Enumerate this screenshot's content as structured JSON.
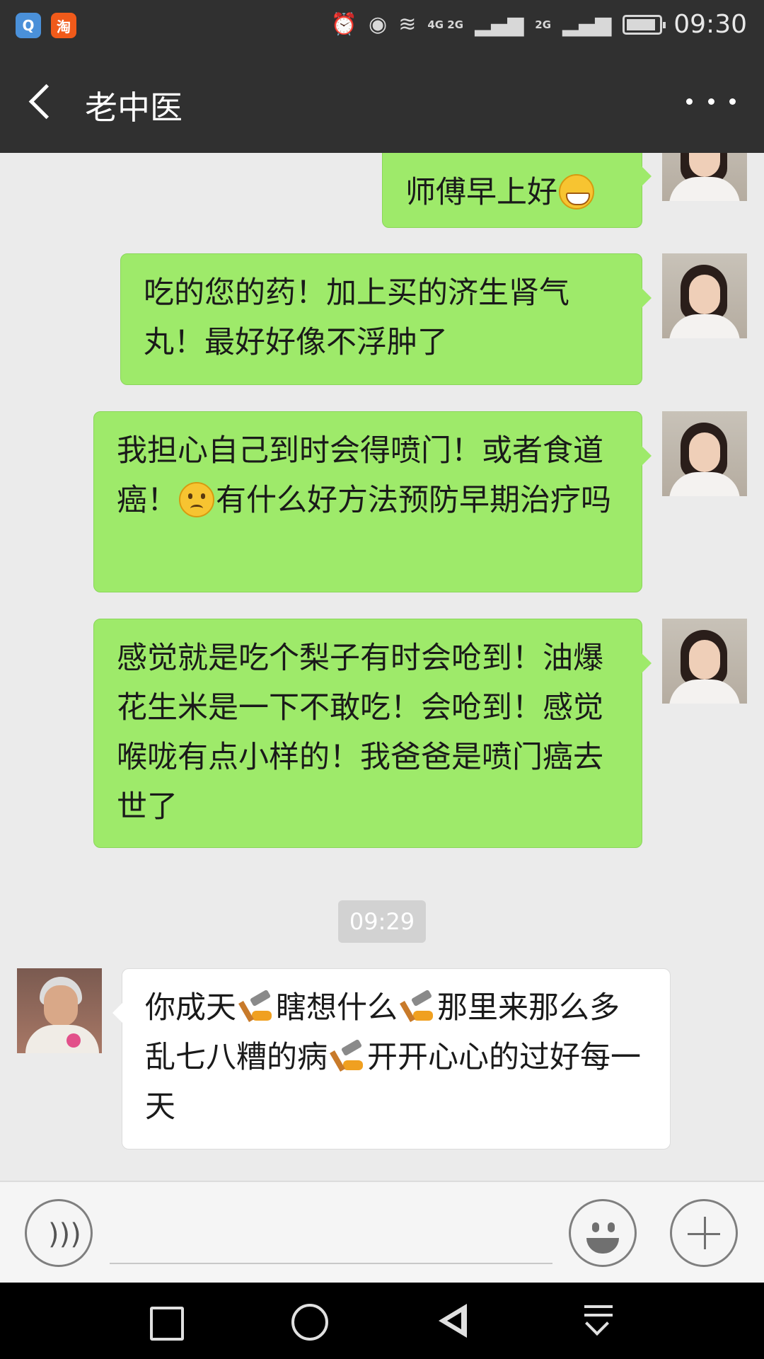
{
  "status_bar": {
    "time": "09:30",
    "app_icons": [
      {
        "name": "qq-browser-icon",
        "glyph": "Q"
      },
      {
        "name": "taobao-icon",
        "glyph": "淘"
      }
    ],
    "network_1": "4G 2G",
    "network_2": "2G",
    "icons": [
      "alarm-icon",
      "eye-icon",
      "wifi-icon",
      "signal-icon",
      "battery-icon"
    ]
  },
  "header": {
    "title": "老中医",
    "back_icon": "chevron-left-icon",
    "more_icon": "more-dots-icon"
  },
  "messages": [
    {
      "side": "out",
      "sender": "me",
      "text": "师傅早上好",
      "emoji_after": "grin-emoji"
    },
    {
      "side": "out",
      "sender": "me",
      "text": "吃的您的药！加上买的济生肾气丸！最好好像不浮肿了"
    },
    {
      "side": "out",
      "sender": "me",
      "text_before": "我担心自己到时会得喷门！或者食道癌！",
      "emoji": "sad-emoji",
      "text_after": "有什么好方法预防早期治疗吗"
    },
    {
      "side": "out",
      "sender": "me",
      "text": "感觉就是吃个梨子有时会呛到！油爆花生米是一下不敢吃！会呛到！感觉喉咙有点小样的！我爸爸是喷门癌去世了"
    },
    {
      "side": "in",
      "sender": "老中医",
      "parts": [
        "你成天",
        "瞎想什么",
        "那里来那么多乱七八糟的病",
        "开开心心的过好每一天"
      ],
      "emoji": "hammer-emoji"
    }
  ],
  "timestamp": "09:29",
  "input_bar": {
    "voice_icon": "voice-icon",
    "emoji_icon": "smiley-icon",
    "plus_icon": "plus-icon",
    "placeholder": ""
  },
  "nav_bar": {
    "icons": [
      "recent-apps-icon",
      "home-icon",
      "back-icon",
      "notification-pulldown-icon"
    ]
  }
}
